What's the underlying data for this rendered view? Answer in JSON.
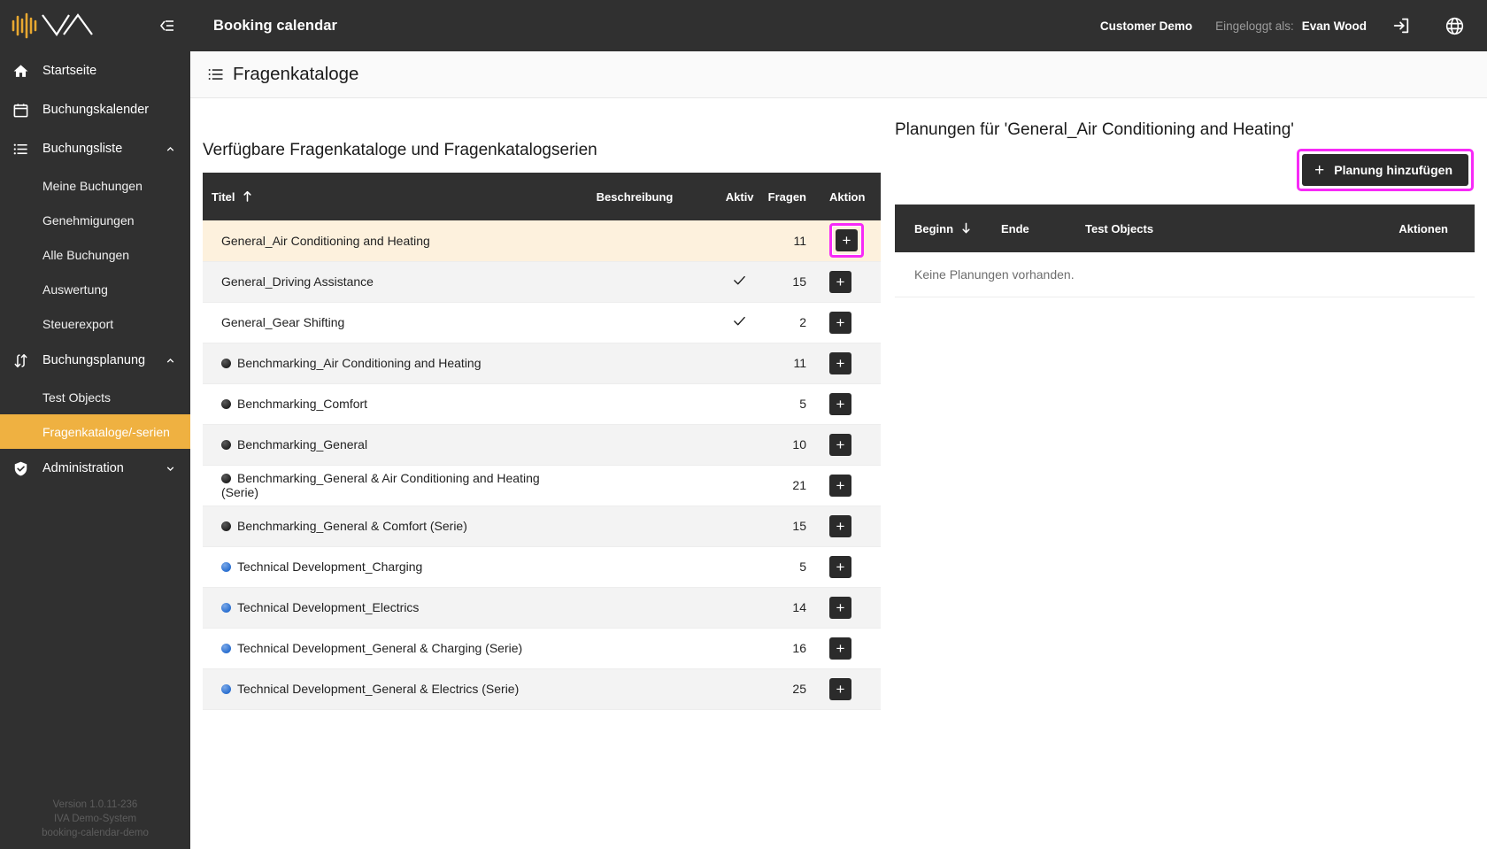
{
  "sidebar": {
    "logo_alt": "IVA logo",
    "collapse_icon": "collapse-panel-icon",
    "items": [
      {
        "label": "Startseite",
        "icon": "home-icon",
        "type": "item",
        "active": false,
        "expandable": false
      },
      {
        "label": "Buchungskalender",
        "icon": "calendar-icon",
        "type": "item",
        "active": false,
        "expandable": false
      },
      {
        "label": "Buchungsliste",
        "icon": "list-icon",
        "type": "item",
        "active": false,
        "expandable": true,
        "expanded": true
      },
      {
        "label": "Meine Buchungen",
        "icon": "",
        "type": "sub",
        "active": false
      },
      {
        "label": "Genehmigungen",
        "icon": "",
        "type": "sub",
        "active": false
      },
      {
        "label": "Alle Buchungen",
        "icon": "",
        "type": "sub",
        "active": false
      },
      {
        "label": "Auswertung",
        "icon": "",
        "type": "sub",
        "active": false
      },
      {
        "label": "Steuerexport",
        "icon": "",
        "type": "sub",
        "active": false
      },
      {
        "label": "Buchungsplanung",
        "icon": "swap-vertical-icon",
        "type": "item",
        "active": false,
        "expandable": true,
        "expanded": true
      },
      {
        "label": "Test Objects",
        "icon": "",
        "type": "sub",
        "active": false
      },
      {
        "label": "Fragenkataloge/-serien",
        "icon": "",
        "type": "sub",
        "active": true
      },
      {
        "label": "Administration",
        "icon": "shield-check-icon",
        "type": "item",
        "active": false,
        "expandable": true,
        "expanded": false
      }
    ],
    "footer": {
      "version": "Version 1.0.11-236",
      "system": "IVA Demo-System",
      "instance": "booking-calendar-demo"
    },
    "active_color": "#efb141",
    "background": "#303030"
  },
  "topbar": {
    "app_title": "Booking calendar",
    "customer": "Customer Demo",
    "logged_in_label": "Eingeloggt als:",
    "username": "Evan Wood",
    "logout_icon": "logout-icon",
    "language_icon": "globe-icon",
    "background": "#303030"
  },
  "page_header": {
    "icon": "list-bullet-icon",
    "title": "Fragenkataloge"
  },
  "left_panel": {
    "section_title": "Verfügbare Fragenkataloge und Fragenkatalogserien",
    "columns": [
      {
        "key": "titel",
        "label": "Titel",
        "sorted": true,
        "sort_dir": "asc"
      },
      {
        "key": "beschreibung",
        "label": "Beschreibung",
        "sorted": false
      },
      {
        "key": "aktiv",
        "label": "Aktiv",
        "sorted": false
      },
      {
        "key": "fragen",
        "label": "Fragen",
        "sorted": false
      },
      {
        "key": "aktion",
        "label": "Aktion",
        "sorted": false
      }
    ],
    "rows": [
      {
        "titel": "General_Air Conditioning and Heating",
        "bullet": "none",
        "beschreibung": "",
        "aktiv": false,
        "fragen": "11",
        "action_icon": "plus-icon",
        "selected": true,
        "highlighted_action": true
      },
      {
        "titel": "General_Driving Assistance",
        "bullet": "none",
        "beschreibung": "",
        "aktiv": true,
        "fragen": "15",
        "action_icon": "plus-icon",
        "selected": false,
        "highlighted_action": false
      },
      {
        "titel": "General_Gear Shifting",
        "bullet": "none",
        "beschreibung": "",
        "aktiv": true,
        "fragen": "2",
        "action_icon": "plus-icon",
        "selected": false,
        "highlighted_action": false
      },
      {
        "titel": "Benchmarking_Air Conditioning and Heating",
        "bullet": "dark",
        "beschreibung": "",
        "aktiv": false,
        "fragen": "11",
        "action_icon": "plus-icon",
        "selected": false,
        "highlighted_action": false
      },
      {
        "titel": "Benchmarking_Comfort",
        "bullet": "dark",
        "beschreibung": "",
        "aktiv": false,
        "fragen": "5",
        "action_icon": "plus-icon",
        "selected": false,
        "highlighted_action": false
      },
      {
        "titel": "Benchmarking_General",
        "bullet": "dark",
        "beschreibung": "",
        "aktiv": false,
        "fragen": "10",
        "action_icon": "plus-icon",
        "selected": false,
        "highlighted_action": false
      },
      {
        "titel": "Benchmarking_General & Air Conditioning and Heating (Serie)",
        "bullet": "dark",
        "beschreibung": "",
        "aktiv": false,
        "fragen": "21",
        "action_icon": "plus-icon",
        "selected": false,
        "highlighted_action": false
      },
      {
        "titel": "Benchmarking_General & Comfort (Serie)",
        "bullet": "dark",
        "beschreibung": "",
        "aktiv": false,
        "fragen": "15",
        "action_icon": "plus-icon",
        "selected": false,
        "highlighted_action": false
      },
      {
        "titel": "Technical Development_Charging",
        "bullet": "blue",
        "beschreibung": "",
        "aktiv": false,
        "fragen": "5",
        "action_icon": "plus-icon",
        "selected": false,
        "highlighted_action": false
      },
      {
        "titel": "Technical Development_Electrics",
        "bullet": "blue",
        "beschreibung": "",
        "aktiv": false,
        "fragen": "14",
        "action_icon": "plus-icon",
        "selected": false,
        "highlighted_action": false
      },
      {
        "titel": "Technical Development_General & Charging (Serie)",
        "bullet": "blue",
        "beschreibung": "",
        "aktiv": false,
        "fragen": "16",
        "action_icon": "plus-icon",
        "selected": false,
        "highlighted_action": false
      },
      {
        "titel": "Technical Development_General & Electrics (Serie)",
        "bullet": "blue",
        "beschreibung": "",
        "aktiv": false,
        "fragen": "25",
        "action_icon": "plus-icon",
        "selected": false,
        "highlighted_action": false
      }
    ]
  },
  "right_panel": {
    "title": "Planungen für 'General_Air Conditioning and Heating'",
    "add_button": {
      "label": "Planung hinzufügen",
      "icon": "plus-icon",
      "highlighted": true
    },
    "columns": [
      {
        "key": "beginn",
        "label": "Beginn",
        "sorted": true,
        "sort_dir": "desc"
      },
      {
        "key": "ende",
        "label": "Ende",
        "sorted": false
      },
      {
        "key": "test_objects",
        "label": "Test Objects",
        "sorted": false
      },
      {
        "key": "aktionen",
        "label": "Aktionen",
        "sorted": false
      }
    ],
    "rows": [],
    "empty_message": "Keine Planungen vorhanden."
  },
  "colors": {
    "highlight_ring": "#f72af7",
    "sidebar_active": "#efb141",
    "dark": "#303030",
    "selected_row": "#fdf1dd",
    "bullet_dark": "#222222",
    "bullet_blue": "#2a6fd0"
  }
}
